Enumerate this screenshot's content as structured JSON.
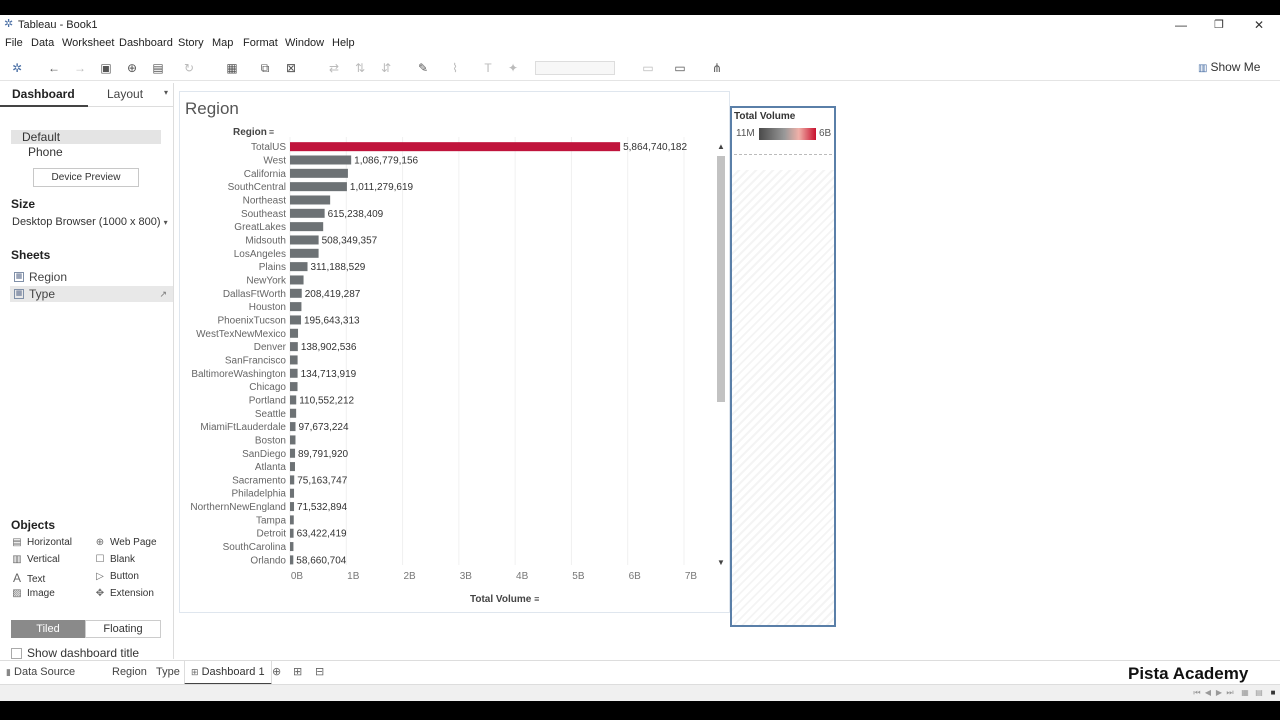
{
  "window": {
    "title": "Tableau - Book1",
    "controls": {
      "minimize": "—",
      "maximize": "❐",
      "close": "✕"
    }
  },
  "menu": [
    "File",
    "Data",
    "Worksheet",
    "Dashboard",
    "Story",
    "Map",
    "Format",
    "Window",
    "Help"
  ],
  "toolbar": {
    "show_me": "Show Me"
  },
  "left_pane": {
    "tabs": {
      "dashboard": "Dashboard",
      "layout": "Layout"
    },
    "device": {
      "default": "Default",
      "phone": "Phone",
      "preview_button": "Device Preview"
    },
    "size": {
      "heading": "Size",
      "value": "Desktop Browser (1000 x 800)"
    },
    "sheets": {
      "heading": "Sheets",
      "items": [
        {
          "label": "Region"
        },
        {
          "label": "Type"
        }
      ]
    },
    "objects": {
      "heading": "Objects",
      "items": {
        "horizontal": "Horizontal",
        "web_page": "Web Page",
        "vertical": "Vertical",
        "blank": "Blank",
        "text": "Text",
        "button": "Button",
        "image": "Image",
        "extension": "Extension"
      }
    },
    "mode": {
      "tiled": "Tiled",
      "floating": "Floating"
    },
    "show_title_label": "Show dashboard title"
  },
  "sheet": {
    "title": "Region",
    "row_header": "Region",
    "x_axis_label": "Total Volume"
  },
  "legend": {
    "title": "Total Volume",
    "min_label": "11M",
    "max_label": "6B",
    "colors": {
      "low": "#4a4a4a",
      "high": "#c8102e"
    }
  },
  "chart_data": {
    "type": "bar",
    "orientation": "horizontal",
    "categories": [
      "TotalUS",
      "West",
      "California",
      "SouthCentral",
      "Northeast",
      "Southeast",
      "GreatLakes",
      "Midsouth",
      "LosAngeles",
      "Plains",
      "NewYork",
      "DallasFtWorth",
      "Houston",
      "PhoenixTucson",
      "WestTexNewMexico",
      "Denver",
      "SanFrancisco",
      "BaltimoreWashington",
      "Chicago",
      "Portland",
      "Seattle",
      "MiamiFtLauderdale",
      "Boston",
      "SanDiego",
      "Atlanta",
      "Sacramento",
      "Philadelphia",
      "NorthernNewEngland",
      "Tampa",
      "Detroit",
      "SouthCarolina",
      "Orlando"
    ],
    "values": [
      5864740182,
      1086779156,
      1028982000,
      1011279619,
      713280000,
      615238409,
      589625000,
      508349357,
      507896000,
      311188529,
      240734000,
      208419287,
      203167000,
      195643313,
      142789000,
      138902536,
      135030000,
      134713919,
      133602000,
      110552212,
      109214000,
      97673224,
      97273000,
      89791920,
      88605000,
      75163747,
      71838000,
      71532894,
      67040000,
      63422419,
      60946000,
      58660704
    ],
    "data_labels": [
      "5,864,740,182",
      "1,086,779,156",
      "",
      "1,011,279,619",
      "",
      "615,238,409",
      "",
      "508,349,357",
      "",
      "311,188,529",
      "",
      "208,419,287",
      "",
      "195,643,313",
      "",
      "138,902,536",
      "",
      "134,713,919",
      "",
      "110,552,212",
      "",
      "97,673,224",
      "",
      "89,791,920",
      "",
      "75,163,747",
      "",
      "71,532,894",
      "",
      "63,422,419",
      "",
      "58,660,704"
    ],
    "x_ticks": [
      "0B",
      "1B",
      "2B",
      "3B",
      "4B",
      "5B",
      "6B",
      "7B"
    ],
    "xlim": [
      0,
      7000000000
    ],
    "xlabel": "Total Volume",
    "ylabel": "Region",
    "colors": {
      "highlight": "#c0143c",
      "default": "#6d7275"
    }
  },
  "sheet_tabs": {
    "data_source": "Data Source",
    "tabs": [
      "Region",
      "Type"
    ],
    "active": "Dashboard 1"
  },
  "watermark": "Pista Academy"
}
